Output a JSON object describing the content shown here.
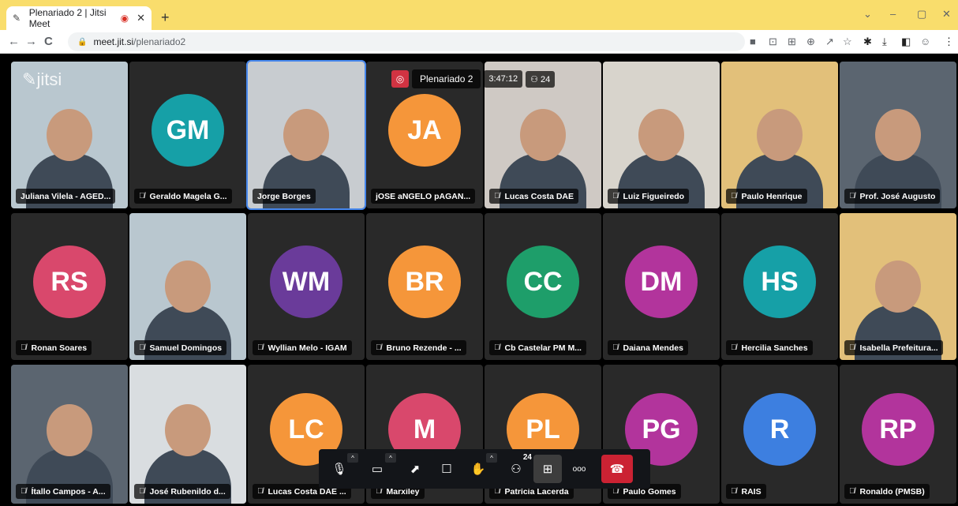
{
  "browser": {
    "tab_title": "Plenariado 2 | Jitsi Meet",
    "url_domain": "meet.jit.si",
    "url_path": "/plenariado2"
  },
  "meeting": {
    "room_name": "Plenariado 2",
    "timer": "3:47:12",
    "participant_count": "24",
    "logo": "jitsi"
  },
  "participants": [
    {
      "name": "Juliana Vilela - AGED...",
      "initials": "",
      "color": "",
      "video": true,
      "muted": false
    },
    {
      "name": "Geraldo Magela G...",
      "initials": "GM",
      "color": "#16a0a7",
      "video": false,
      "muted": true
    },
    {
      "name": "Jorge Borges",
      "initials": "",
      "color": "",
      "video": true,
      "muted": false,
      "active": true
    },
    {
      "name": "jOSE aNGELO pAGAN...",
      "initials": "JA",
      "color": "#f5963a",
      "video": false,
      "muted": false
    },
    {
      "name": "Lucas Costa DAE",
      "initials": "",
      "color": "",
      "video": true,
      "muted": true
    },
    {
      "name": "Luiz Figueiredo",
      "initials": "",
      "color": "",
      "video": true,
      "muted": true
    },
    {
      "name": "Paulo Henrique",
      "initials": "",
      "color": "",
      "video": true,
      "muted": true
    },
    {
      "name": "Prof. José Augusto",
      "initials": "",
      "color": "",
      "video": true,
      "muted": true
    },
    {
      "name": "Ronan Soares",
      "initials": "RS",
      "color": "#d9486c",
      "video": false,
      "muted": true
    },
    {
      "name": "Samuel Domingos",
      "initials": "",
      "color": "",
      "video": true,
      "muted": true
    },
    {
      "name": "Wyllian Melo - IGAM",
      "initials": "WM",
      "color": "#6a3b9a",
      "video": false,
      "muted": true
    },
    {
      "name": "Bruno Rezende - ...",
      "initials": "BR",
      "color": "#f5963a",
      "video": false,
      "muted": true
    },
    {
      "name": "Cb Castelar PM M...",
      "initials": "CC",
      "color": "#1e9e6a",
      "video": false,
      "muted": true
    },
    {
      "name": "Daiana Mendes",
      "initials": "DM",
      "color": "#b2349c",
      "video": false,
      "muted": true
    },
    {
      "name": "Hercilia Sanches",
      "initials": "HS",
      "color": "#16a0a7",
      "video": false,
      "muted": true
    },
    {
      "name": "Isabella Prefeitura...",
      "initials": "",
      "color": "",
      "video": true,
      "muted": true
    },
    {
      "name": "Ítallo Campos - A...",
      "initials": "",
      "color": "",
      "video": true,
      "muted": true
    },
    {
      "name": "José Rubenildo d...",
      "initials": "",
      "color": "",
      "video": true,
      "muted": true
    },
    {
      "name": "Lucas Costa DAE ...",
      "initials": "LC",
      "color": "#f5963a",
      "video": false,
      "muted": true
    },
    {
      "name": "Marxiley",
      "initials": "M",
      "color": "#d9486c",
      "video": false,
      "muted": true
    },
    {
      "name": "Patrícia Lacerda",
      "initials": "PL",
      "color": "#f5963a",
      "video": false,
      "muted": true
    },
    {
      "name": "Paulo Gomes",
      "initials": "PG",
      "color": "#b2349c",
      "video": false,
      "muted": true
    },
    {
      "name": "RAIS",
      "initials": "R",
      "color": "#3d7fe0",
      "video": false,
      "muted": true
    },
    {
      "name": "Ronaldo (PMSB)",
      "initials": "RP",
      "color": "#b2349c",
      "video": false,
      "muted": true
    }
  ],
  "toolbar": {
    "participants_badge": "24",
    "more_label": "ooo"
  },
  "icons": [
    "microphone-icon",
    "camera-icon",
    "share-screen-icon",
    "chat-icon",
    "raise-hand-icon",
    "participants-icon",
    "tile-view-icon",
    "more-icon",
    "hangup-icon",
    "globe-icon",
    "muted-mic-icon"
  ]
}
